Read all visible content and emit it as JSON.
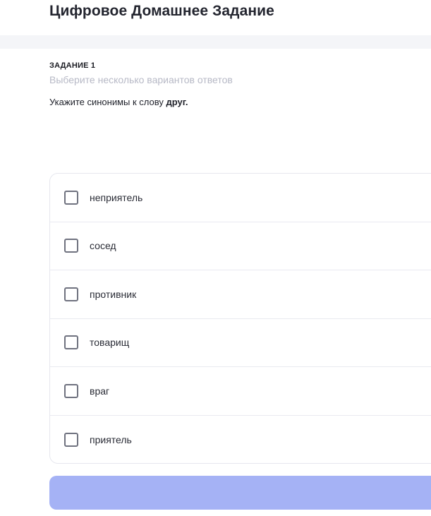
{
  "header": {
    "title": "Цифровое Домашнее Задание"
  },
  "task": {
    "label": "ЗАДАНИЕ 1",
    "hint": "Выберите несколько вариантов ответов",
    "question_prefix": "Укажите синонимы к слову ",
    "question_word": "друг."
  },
  "options": [
    {
      "label": "неприятель",
      "checked": false
    },
    {
      "label": "сосед",
      "checked": false
    },
    {
      "label": "противник",
      "checked": false
    },
    {
      "label": "товарищ",
      "checked": false
    },
    {
      "label": "враг",
      "checked": false
    },
    {
      "label": "приятель",
      "checked": false
    }
  ],
  "colors": {
    "submit_button": "#a5b2f5",
    "checkbox_border": "#6f727f",
    "hint_text": "#b7b9c6"
  }
}
